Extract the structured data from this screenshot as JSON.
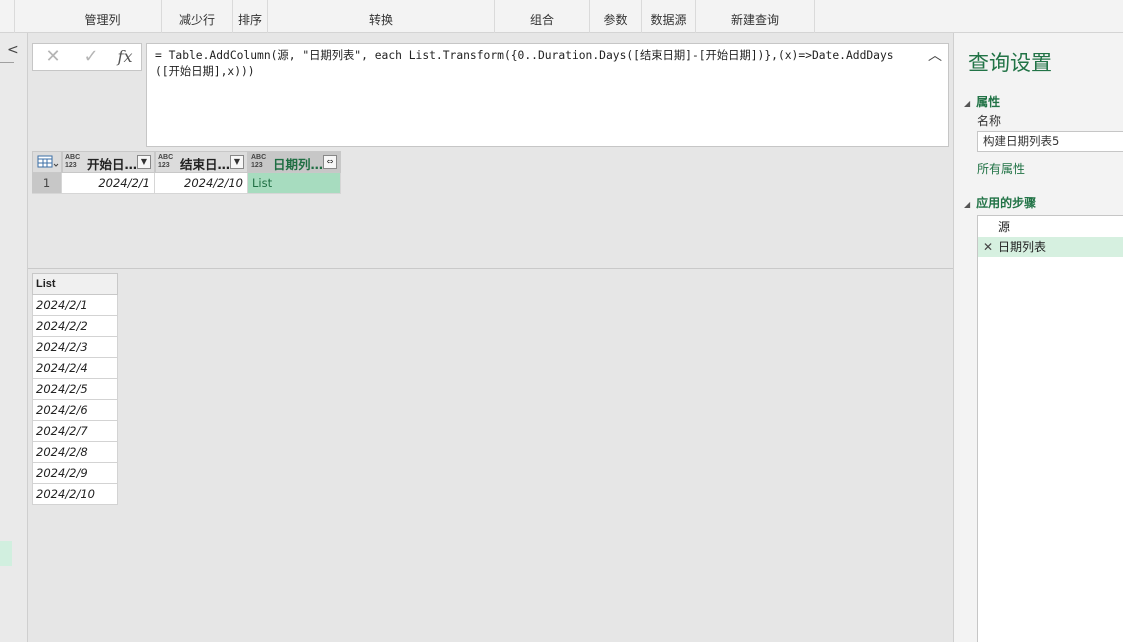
{
  "ribbon": {
    "groups": [
      "管理列",
      "减少行",
      "排序",
      "转换",
      "组合",
      "参数",
      "数据源",
      "新建查询"
    ]
  },
  "formula_bar": {
    "cancel_icon": "✕",
    "confirm_icon": "✓",
    "fx_label": "fx",
    "formula": "= Table.AddColumn(源, \"日期列表\", each List.Transform({0..Duration.Days([结束日期]-[开始日期])},(x)=>Date.AddDays([开始日期],x)))",
    "collapse_icon": "︿"
  },
  "grid": {
    "type_label": "ABC\n123",
    "columns": [
      {
        "name": "开始日…"
      },
      {
        "name": "结束日…"
      },
      {
        "name": "日期列…"
      }
    ],
    "rows": [
      {
        "index": "1",
        "start": "2024/2/1",
        "end": "2024/2/10",
        "list": "List"
      }
    ]
  },
  "preview": {
    "header": "List",
    "items": [
      "2024/2/1",
      "2024/2/2",
      "2024/2/3",
      "2024/2/4",
      "2024/2/5",
      "2024/2/6",
      "2024/2/7",
      "2024/2/8",
      "2024/2/9",
      "2024/2/10"
    ]
  },
  "query_settings": {
    "title": "查询设置",
    "properties_heading": "属性",
    "name_label": "名称",
    "name_value": "构建日期列表5",
    "all_properties": "所有属性",
    "applied_steps_heading": "应用的步骤",
    "steps": [
      "源",
      "日期列表"
    ]
  },
  "colors": {
    "accent": "#217346",
    "selected_cell": "#a7dcbf",
    "active_step": "#d6f0e0"
  }
}
